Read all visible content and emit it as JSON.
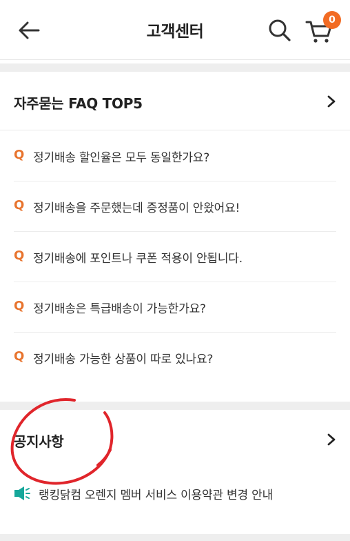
{
  "header": {
    "title": "고객센터",
    "cart_count": "0"
  },
  "faq": {
    "title": "자주묻는 FAQ TOP5",
    "q_marker": "Q",
    "items": [
      "정기배송 할인율은 모두 동일한가요?",
      "정기배송을 주문했는데 증정품이 안왔어요!",
      "정기배송에 포인트나 쿠폰 적용이 안됩니다.",
      "정기배송은 특급배송이 가능한가요?",
      "정기배송 가능한 상품이 따로 있나요?"
    ]
  },
  "notice": {
    "title": "공지사항",
    "items": [
      "랭킹닭컴 오렌지 멤버 서비스 이용약관 변경 안내"
    ]
  },
  "colors": {
    "accent": "#f26b23",
    "q_marker": "#e8742e",
    "speaker_icon": "#16a79a",
    "annotation": "#e0252b",
    "divider_band": "#eeeeee"
  },
  "icons": [
    "back-arrow-icon",
    "search-icon",
    "cart-icon",
    "chevron-right-icon",
    "speaker-icon"
  ]
}
